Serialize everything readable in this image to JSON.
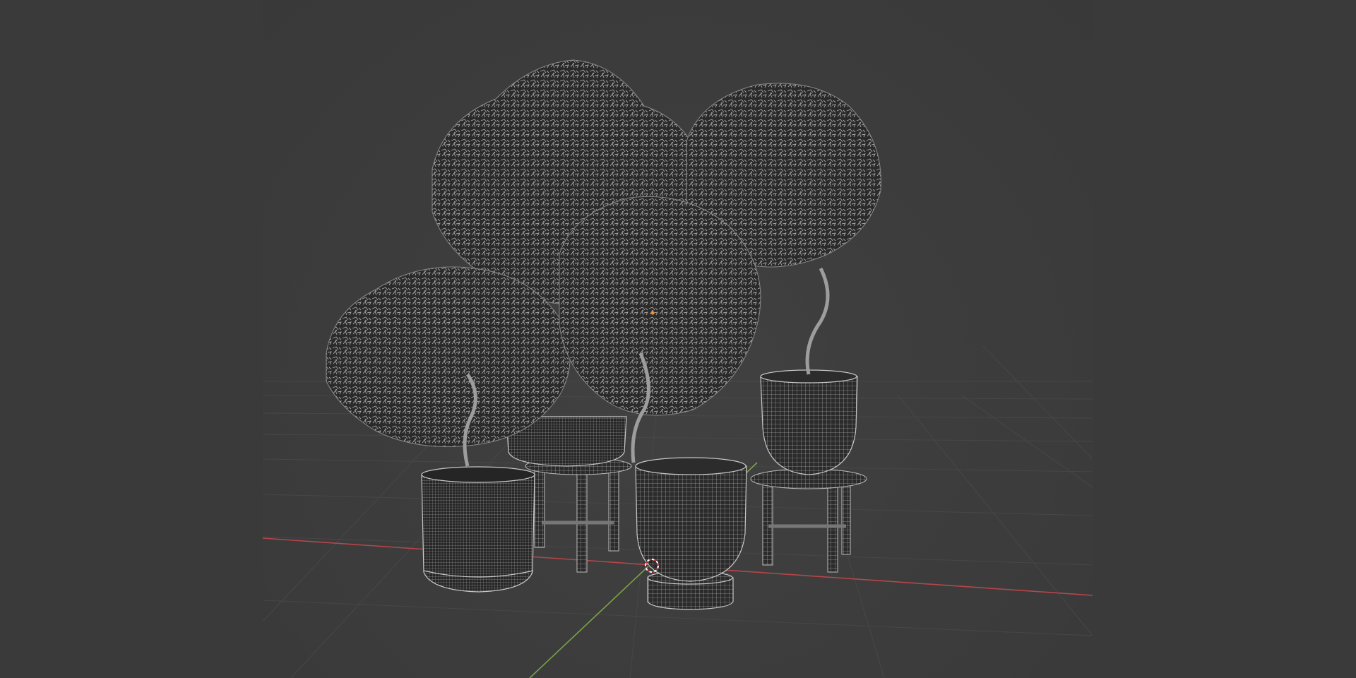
{
  "viewport": {
    "mode": "wireframe",
    "background_color": "#3d3d3d",
    "grid_color": "#4a4a4a",
    "x_axis_color": "#b4464b",
    "y_axis_color": "#7ca245",
    "wire_color": "#b8b8b8",
    "cursor_icon": "3d-cursor-icon",
    "origin_marker_color": "#ff8a1f"
  },
  "objects": [
    {
      "name": "potted-tree-left",
      "pot": "cylinder-pot"
    },
    {
      "name": "potted-tree-back",
      "pot": "round-pot-on-stool"
    },
    {
      "name": "potted-tree-center",
      "pot": "bowl-pot-on-base"
    },
    {
      "name": "potted-tree-right",
      "pot": "bowl-pot-on-stool"
    }
  ]
}
